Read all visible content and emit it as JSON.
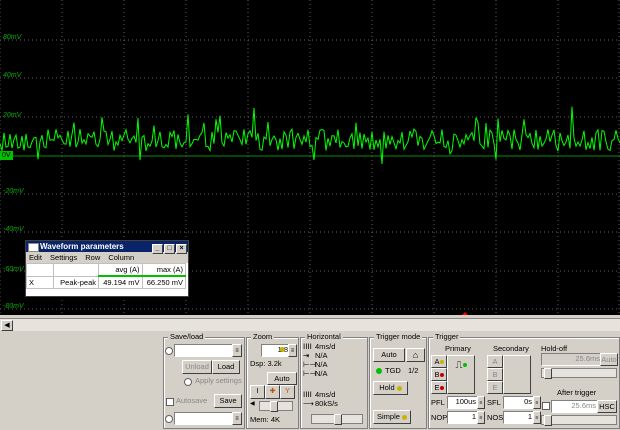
{
  "scope": {
    "y_labels": [
      "80mV",
      "40mV",
      "20mV",
      "0V",
      "-20mV",
      "-40mV",
      "-60mV",
      "-80mV"
    ],
    "ground_marker": "0V",
    "trace_color": "#00ff00",
    "grid_color": "#606060"
  },
  "wave_params": {
    "title": "Waveform parameters",
    "menu": [
      "Edit",
      "Settings",
      "Row",
      "Column"
    ],
    "col_avg": "avg (A)",
    "col_max": "max (A)",
    "row_close": "X",
    "row_name": "Peak-peak",
    "row_avg": "49.194 mV",
    "row_max": "66.250 mV"
  },
  "saveload": {
    "label": "Save/load",
    "unload": "Unload",
    "load": "Load",
    "apply_settings": "Apply settings",
    "autosave": "Autosave",
    "save": "Save"
  },
  "zoom": {
    "label": "Zoom",
    "ratio": "1:8",
    "dsp": "Dsp: 3.2k",
    "auto": "Auto",
    "mem": "Mem: 4K"
  },
  "horizontal": {
    "label": "Horizontal",
    "time_div": "4ms/d",
    "na1": "N/A",
    "na2": "N/A",
    "na3": "N/A",
    "time_div2": "4ms/d",
    "sample_rate": "80kS/s"
  },
  "trigger_mode": {
    "label": "Trigger mode",
    "auto": "Auto",
    "tgd": "TGD",
    "half": "1/2",
    "hold": "Hold",
    "simple": "Simple"
  },
  "trigger": {
    "label": "Trigger",
    "primary": "Primary",
    "secondary": "Secondary",
    "holdoff": "Hold-off",
    "holdoff_val": "25.6ms",
    "holdoff_auto": "Auto",
    "chan_a": "A",
    "chan_b": "B",
    "chan_e": "E",
    "pfl": "PFL",
    "pfl_val": "100us",
    "sfl": "SFL",
    "sfl_val": "0s",
    "nop": "NOP",
    "nop_val": "1",
    "nos": "NOS",
    "nos_val": "1",
    "after_trigger": "After trigger",
    "after_val": "25.6ms",
    "hsc": "HSC"
  }
}
